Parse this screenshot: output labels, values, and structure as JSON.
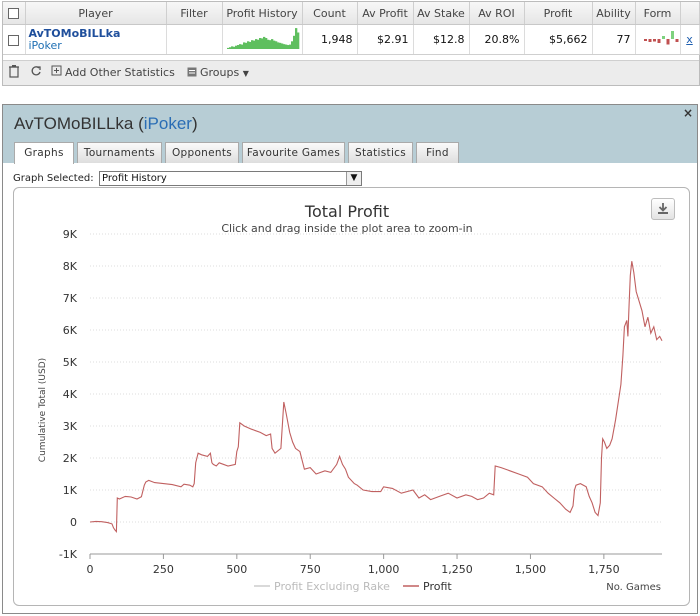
{
  "stats": {
    "headers": [
      "Player",
      "Filter",
      "Profit History",
      "Count",
      "Av Profit",
      "Av Stake",
      "Av ROI",
      "Profit",
      "Ability",
      "Form"
    ],
    "row": {
      "player": "AvTOMoBILLka",
      "network": "iPoker",
      "count": "1,948",
      "av_profit": "$2.91",
      "av_stake": "$12.8",
      "av_roi": "20.8%",
      "profit": "$5,662",
      "ability": "77",
      "x_link": "x"
    },
    "profit_history_spark": [
      0.05,
      0.08,
      0.12,
      0.1,
      0.15,
      0.18,
      0.22,
      0.2,
      0.3,
      0.28,
      0.35,
      0.32,
      0.4,
      0.38,
      0.45,
      0.42,
      0.5,
      0.48,
      0.55,
      0.5,
      0.42,
      0.4,
      0.45,
      0.38,
      0.35,
      0.3,
      0.28,
      0.25,
      0.22,
      0.2,
      0.18,
      0.2,
      0.35,
      0.6,
      0.95,
      0.75
    ],
    "form_bars": [
      -0.2,
      -0.3,
      -0.25,
      -0.4,
      0.3,
      -0.55,
      0.8,
      -0.3
    ],
    "form_colors": {
      "positive": "#7ed27e",
      "negative": "#c05050"
    },
    "toolbar": {
      "add_stats_label": "Add Other Statistics",
      "groups_label": "Groups"
    }
  },
  "panel": {
    "player": "AvTOMoBILLka",
    "network": "iPoker",
    "tabs": [
      "Graphs",
      "Tournaments",
      "Opponents",
      "Favourite Games",
      "Statistics",
      "Find"
    ],
    "active_tab": "Graphs",
    "graph_selected_label": "Graph Selected:",
    "graph_selected_value": "Profit History",
    "close_label": "×"
  },
  "chart_data": {
    "type": "line",
    "title": "Total Profit",
    "subtitle": "Click and drag inside the plot area to zoom-in",
    "ylabel": "Cumulative Total (USD)",
    "xlabel": "No. Games",
    "xlim": [
      0,
      1948
    ],
    "ylim": [
      -1000,
      9000
    ],
    "x_ticks": [
      0,
      250,
      500,
      750,
      1000,
      1250,
      1500,
      1750
    ],
    "x_tick_labels": [
      "0",
      "250",
      "500",
      "750",
      "1,000",
      "1,250",
      "1,500",
      "1,750"
    ],
    "y_ticks": [
      -1000,
      0,
      1000,
      2000,
      3000,
      4000,
      5000,
      6000,
      7000,
      8000,
      9000
    ],
    "y_tick_labels": [
      "-1K",
      "0",
      "1K",
      "2K",
      "3K",
      "4K",
      "5K",
      "6K",
      "7K",
      "8K",
      "9K"
    ],
    "legend": [
      "Profit Excluding Rake",
      "Profit"
    ],
    "legend_colors": [
      "#cccccc",
      "#c06060"
    ],
    "series": [
      {
        "name": "Profit",
        "color": "#c06060",
        "points": [
          [
            0,
            0
          ],
          [
            20,
            20
          ],
          [
            40,
            10
          ],
          [
            60,
            -20
          ],
          [
            75,
            -60
          ],
          [
            80,
            -180
          ],
          [
            85,
            -250
          ],
          [
            90,
            -300
          ],
          [
            93,
            750
          ],
          [
            100,
            720
          ],
          [
            120,
            800
          ],
          [
            140,
            780
          ],
          [
            160,
            720
          ],
          [
            175,
            790
          ],
          [
            185,
            1150
          ],
          [
            190,
            1250
          ],
          [
            200,
            1300
          ],
          [
            220,
            1230
          ],
          [
            250,
            1200
          ],
          [
            280,
            1170
          ],
          [
            310,
            1100
          ],
          [
            320,
            1180
          ],
          [
            340,
            1150
          ],
          [
            350,
            1100
          ],
          [
            355,
            1200
          ],
          [
            360,
            1850
          ],
          [
            368,
            2150
          ],
          [
            380,
            2100
          ],
          [
            400,
            2050
          ],
          [
            410,
            2150
          ],
          [
            415,
            1850
          ],
          [
            420,
            1800
          ],
          [
            430,
            1750
          ],
          [
            440,
            1850
          ],
          [
            470,
            1750
          ],
          [
            495,
            1800
          ],
          [
            500,
            2200
          ],
          [
            505,
            2350
          ],
          [
            510,
            3100
          ],
          [
            525,
            3000
          ],
          [
            550,
            2900
          ],
          [
            580,
            2800
          ],
          [
            600,
            2700
          ],
          [
            615,
            2750
          ],
          [
            620,
            2300
          ],
          [
            630,
            2150
          ],
          [
            650,
            2300
          ],
          [
            655,
            3000
          ],
          [
            660,
            3750
          ],
          [
            668,
            3400
          ],
          [
            680,
            2800
          ],
          [
            690,
            2500
          ],
          [
            700,
            2300
          ],
          [
            715,
            2200
          ],
          [
            730,
            1650
          ],
          [
            750,
            1700
          ],
          [
            770,
            1500
          ],
          [
            800,
            1600
          ],
          [
            820,
            1550
          ],
          [
            840,
            1800
          ],
          [
            850,
            2050
          ],
          [
            860,
            1800
          ],
          [
            870,
            1650
          ],
          [
            880,
            1400
          ],
          [
            900,
            1200
          ],
          [
            910,
            1150
          ],
          [
            930,
            1000
          ],
          [
            960,
            950
          ],
          [
            990,
            950
          ],
          [
            1000,
            1100
          ],
          [
            1030,
            1050
          ],
          [
            1060,
            900
          ],
          [
            1100,
            1000
          ],
          [
            1120,
            750
          ],
          [
            1140,
            850
          ],
          [
            1160,
            700
          ],
          [
            1190,
            800
          ],
          [
            1220,
            900
          ],
          [
            1250,
            750
          ],
          [
            1280,
            850
          ],
          [
            1300,
            800
          ],
          [
            1320,
            700
          ],
          [
            1340,
            750
          ],
          [
            1360,
            900
          ],
          [
            1375,
            850
          ],
          [
            1380,
            1750
          ],
          [
            1400,
            1700
          ],
          [
            1430,
            1600
          ],
          [
            1460,
            1500
          ],
          [
            1490,
            1400
          ],
          [
            1510,
            1200
          ],
          [
            1540,
            1100
          ],
          [
            1560,
            900
          ],
          [
            1580,
            750
          ],
          [
            1600,
            600
          ],
          [
            1620,
            400
          ],
          [
            1635,
            300
          ],
          [
            1645,
            500
          ],
          [
            1650,
            1000
          ],
          [
            1655,
            1150
          ],
          [
            1670,
            1200
          ],
          [
            1690,
            1100
          ],
          [
            1700,
            800
          ],
          [
            1710,
            600
          ],
          [
            1720,
            300
          ],
          [
            1730,
            200
          ],
          [
            1738,
            600
          ],
          [
            1742,
            2000
          ],
          [
            1746,
            2600
          ],
          [
            1752,
            2500
          ],
          [
            1760,
            2300
          ],
          [
            1770,
            2400
          ],
          [
            1778,
            2600
          ],
          [
            1790,
            3200
          ],
          [
            1800,
            3800
          ],
          [
            1808,
            4300
          ],
          [
            1815,
            5200
          ],
          [
            1820,
            6100
          ],
          [
            1828,
            6300
          ],
          [
            1832,
            5800
          ],
          [
            1836,
            6800
          ],
          [
            1840,
            7700
          ],
          [
            1845,
            8150
          ],
          [
            1852,
            7800
          ],
          [
            1860,
            7200
          ],
          [
            1870,
            6900
          ],
          [
            1880,
            6600
          ],
          [
            1890,
            6100
          ],
          [
            1900,
            6400
          ],
          [
            1910,
            5900
          ],
          [
            1920,
            6100
          ],
          [
            1930,
            5700
          ],
          [
            1940,
            5800
          ],
          [
            1948,
            5662
          ]
        ]
      },
      {
        "name": "Profit Excluding Rake",
        "color": "#cccccc",
        "visible": false,
        "points": []
      }
    ]
  }
}
